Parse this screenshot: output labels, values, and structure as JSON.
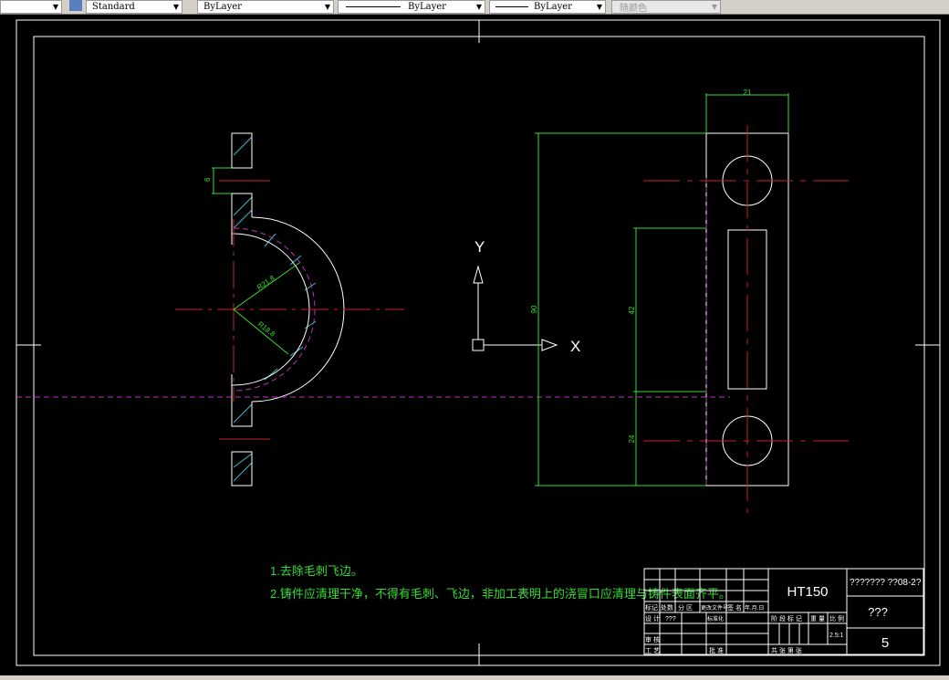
{
  "toolbar": {
    "textstyle": "Standard",
    "layer": "ByLayer",
    "linetype": "ByLayer",
    "lineweight": "ByLayer",
    "plotstyle": "随颜色"
  },
  "colors": {
    "background": "#000000",
    "object": "#ffffff",
    "dimension": "#33dd33",
    "center": "#cc2222",
    "hidden": "#bb33bb",
    "hatch": "#44bbcc"
  },
  "dimensions": {
    "hole": "6",
    "outer_radius": "R21.8",
    "inner_radius": "R18.8",
    "width": "21",
    "height": "90",
    "slot": "42",
    "offset": "24"
  },
  "ucs": {
    "x": "X",
    "y": "Y"
  },
  "notes": [
    "1.去除毛刺飞边。",
    "2.铸件应清理干净，不得有毛刺、飞边，非加工表明上的浇冒口应清理与铸件表面齐平。"
  ],
  "title_block": {
    "material": "HT150",
    "drawing_no": "??????? ??08-2?",
    "name": "???",
    "sheet": "5",
    "scale": "2.5:1",
    "labels": {
      "mark": "标记",
      "count": "处数",
      "zone": "分 区",
      "change_doc": "更改文件号",
      "sign": "签 名",
      "date": "年.月.日",
      "design": "设 计",
      "designer": "???",
      "standard": "标准化",
      "review": "审 核",
      "process": "工 艺",
      "approve": "批 准",
      "stage": "阶 段 标 记",
      "weight": "重 量",
      "scale_label": "比 例",
      "sheets": "共  张  第  张"
    }
  }
}
